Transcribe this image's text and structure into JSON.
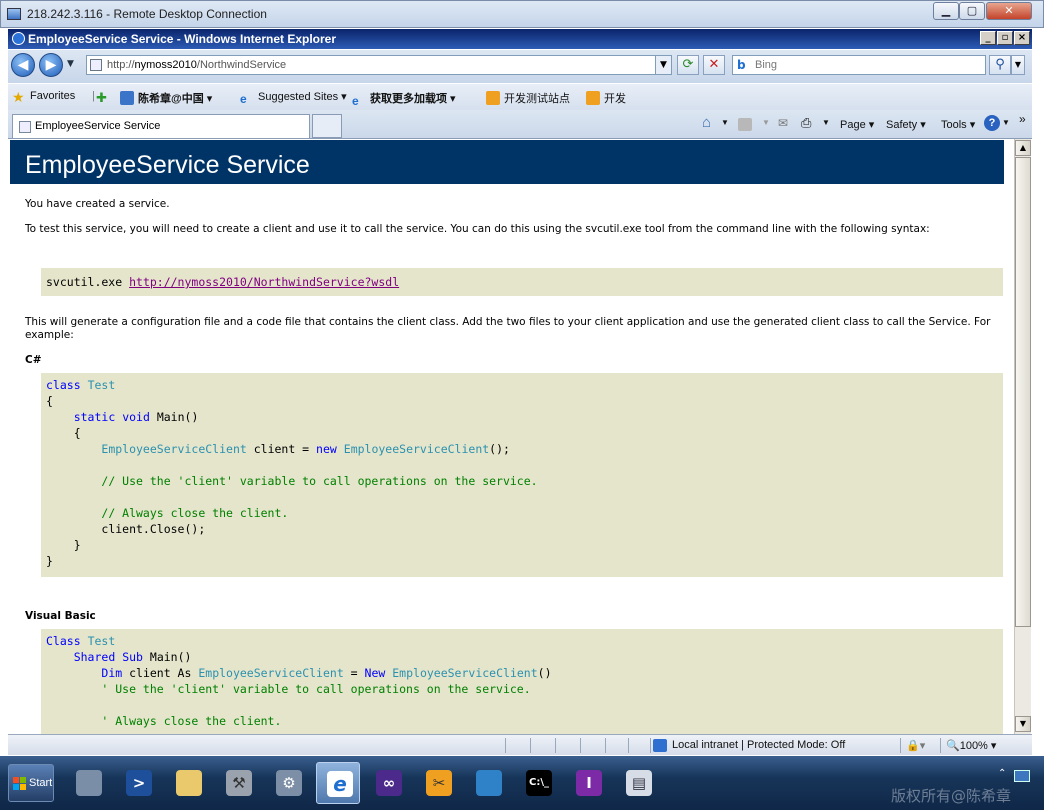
{
  "rdc": {
    "title": "218.242.3.116 - Remote Desktop Connection",
    "min": "▁",
    "max": "▢",
    "close": "✕"
  },
  "ie": {
    "title": "EmployeeService Service - Windows Internet Explorer",
    "min": "_",
    "max": "▫",
    "close": "×",
    "address_prefix": "http://",
    "address_host": "nymoss2010",
    "address_path": "/NorthwindService",
    "search_placeholder": "Bing",
    "search_logo": "b"
  },
  "favorites": {
    "label": "Favorites",
    "items": [
      "陈希章@中国",
      "Suggested Sites",
      "获取更多加载项",
      "开发测试站点",
      "开发"
    ]
  },
  "tabs": {
    "active_label": "EmployeeService Service"
  },
  "commandbar": {
    "page": "Page",
    "safety": "Safety",
    "tools": "Tools",
    "more": "»"
  },
  "page": {
    "heading": "EmployeeService Service",
    "p1": "You have created a service.",
    "p2": "To test this service, you will need to create a client and use it to call the service. You can do this using the svcutil.exe tool from the command line with the following syntax:",
    "svcutil_cmd": "svcutil.exe ",
    "svcutil_link": "http://nymoss2010/NorthwindService?wsdl",
    "p3": "This will generate a configuration file and a code file that contains the client class. Add the two files to your client application and use the generated client class to call the Service. For example:",
    "csharp_label": "C#",
    "vb_label": "Visual Basic",
    "cs": {
      "class_kw": "class",
      "class_name": "Test",
      "brace_open": "{",
      "brace_close": "}",
      "static_kw": "static",
      "void_kw": "void",
      "main": "Main()",
      "client_type": "EmployeeServiceClient",
      "client_var": " client = ",
      "new_kw": "new",
      "ctor": "EmployeeServiceClient",
      "ctor_end": "();",
      "comment1": "// Use the 'client' variable to call operations on the service.",
      "comment2": "// Always close the client.",
      "close_call": "client.Close();"
    },
    "vb": {
      "class_kw": "Class",
      "class_name": "Test",
      "shared_kw": "Shared",
      "sub_kw": "Sub",
      "main": "Main()",
      "dim_kw": "Dim",
      "dim_rest": " client As ",
      "client_type": "EmployeeServiceClient",
      "eq": " = ",
      "new_kw": "New",
      "ctor": "EmployeeServiceClient",
      "ctor_end": "()",
      "comment1": "' Use the 'client' variable to call operations on the service.",
      "comment2": "' Always close the client."
    }
  },
  "status": {
    "zone": "Local intranet | Protected Mode: Off",
    "zoom": "100%"
  },
  "taskbar": {
    "start": "Start"
  },
  "watermark": "版权所有@陈希章",
  "colors": {
    "heading_bg": "#003366",
    "code_bg": "#e5e5cc",
    "keyword": "#0000ff",
    "type": "#2b91af",
    "comment": "#008000",
    "link": "#800080"
  }
}
